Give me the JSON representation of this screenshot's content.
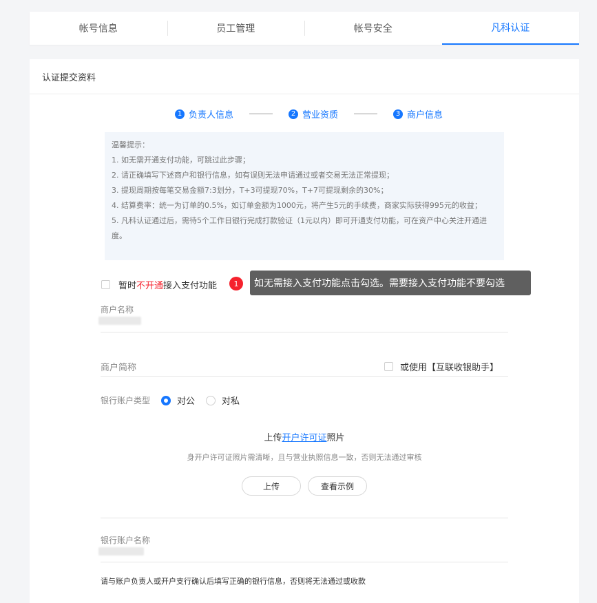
{
  "tabs": [
    {
      "label": "帐号信息"
    },
    {
      "label": "员工管理"
    },
    {
      "label": "帐号安全"
    },
    {
      "label": "凡科认证",
      "active": true
    }
  ],
  "card": {
    "title": "认证提交资料",
    "steps": [
      {
        "num": "1",
        "label": "负责人信息"
      },
      {
        "num": "2",
        "label": "营业资质"
      },
      {
        "num": "3",
        "label": "商户信息"
      }
    ],
    "notice": [
      "温馨提示：",
      "1. 如无需开通支付功能，可跳过此步骤；",
      "2. 请正确填写下述商户和银行信息，如有误则无法申请通过或者交易无法正常提现；",
      "3. 提现周期按每笔交易金额7:3划分，T+3可提现70%，T+7可提现剩余的30%；",
      "4. 结算费率：统一为订单的0.5%，如订单金额为1000元，将产生5元的手续费，商家实际获得995元的收益；",
      "5. 凡科认证通过后，需待5个工作日银行完成打款验证（1元以内）即可开通支付功能，可在资产中心关注开通进度。"
    ],
    "optout": {
      "prefix": "暂时",
      "highlight": "不开通",
      "suffix": "接入支付功能"
    },
    "badge": "1",
    "tooltip": "如无需接入支付功能点击勾选。需要接入支付功能不要勾选",
    "merchant_name_label": "商户名称",
    "merchant_short_label": "商户简称",
    "assistant_label": "或使用【互联收银助手】",
    "account_type_label": "银行账户类型",
    "account_type_options": [
      "对公",
      "对私"
    ],
    "upload": {
      "prefix": "上传",
      "link": "开户许可证",
      "suffix": "照片",
      "hint": "身开户许可证照片需清晰，且与营业执照信息一致，否则无法通过审核",
      "upload_button": "上传",
      "example_button": "查看示例"
    },
    "bank_account_name_label": "银行账户名称",
    "bottom_note": "请与账户负责人或开户支行确认后填写正确的银行信息，否则将无法通过或收款"
  },
  "colors": {
    "accent": "#1677ff",
    "danger": "#f5222d"
  }
}
